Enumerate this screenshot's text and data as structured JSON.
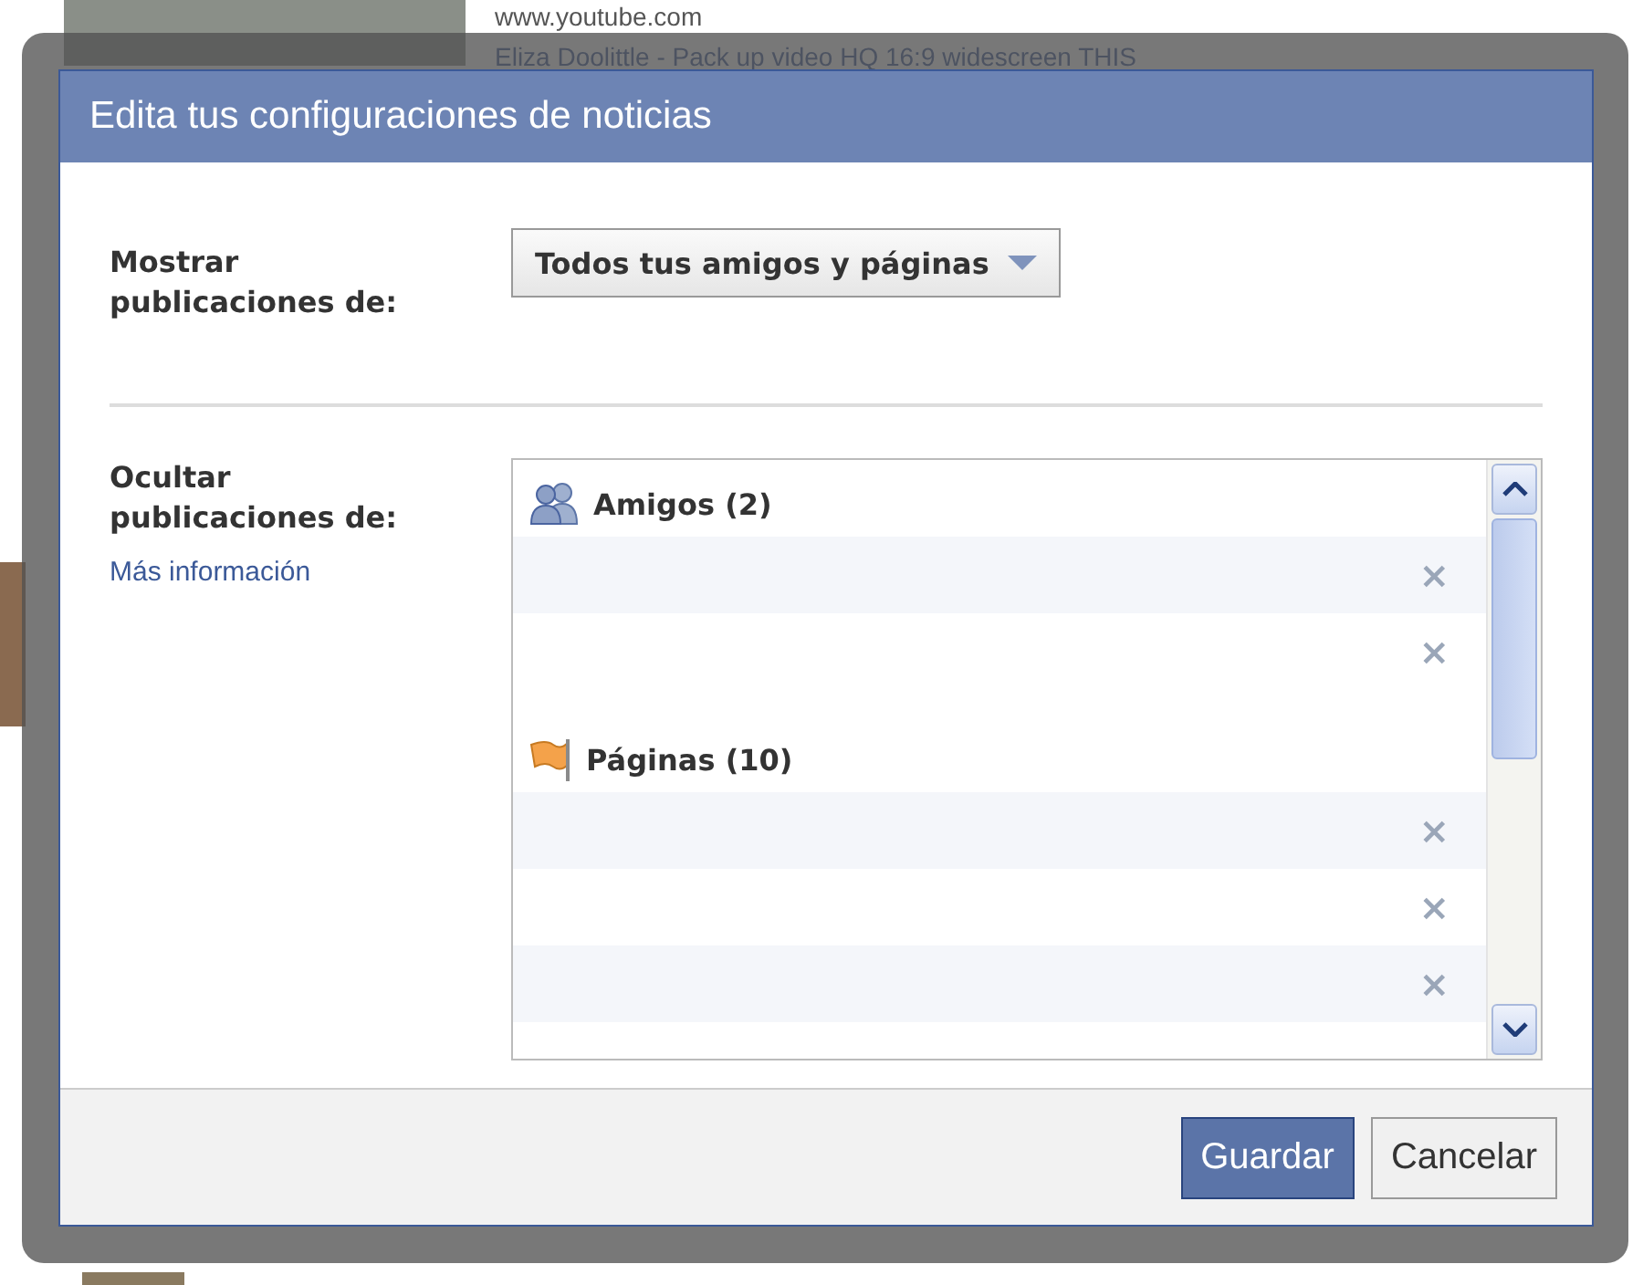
{
  "background_page": {
    "link": "www.youtube.com",
    "video_title": "Eliza Doolittle - Pack up video HQ 16:9 widescreen THIS"
  },
  "dialog": {
    "title": "Edita tus configuraciones de noticias",
    "show_label": "Mostrar publicaciones de:",
    "show_dropdown": {
      "value": "Todos tus amigos y páginas"
    },
    "hide_label": "Ocultar publicaciones de:",
    "more_info_link": "Más información",
    "hidden_list": {
      "groups": [
        {
          "kind": "friends",
          "title": "Amigos (2)",
          "rows": [
            {
              "remove": "×"
            },
            {
              "remove": "×"
            }
          ]
        },
        {
          "kind": "pages",
          "title": "Páginas (10)",
          "rows": [
            {
              "remove": "×"
            },
            {
              "remove": "×"
            },
            {
              "remove": "×"
            }
          ]
        }
      ]
    },
    "buttons": [
      {
        "label": "Guardar",
        "kind": "primary"
      },
      {
        "label": "Cancelar",
        "kind": "secondary"
      }
    ]
  }
}
